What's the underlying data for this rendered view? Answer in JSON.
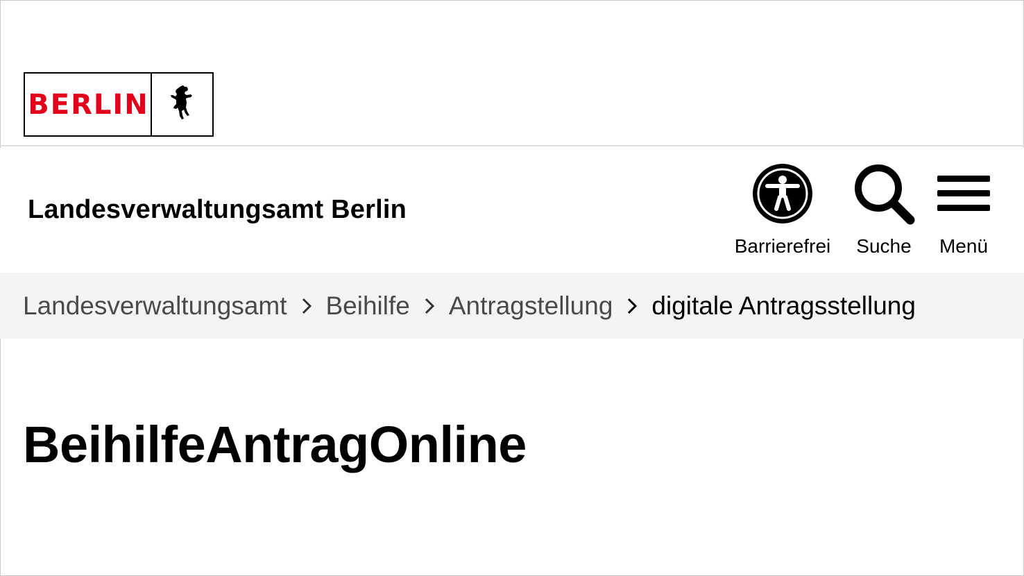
{
  "logo": {
    "text": "BERLIN",
    "brand_color": "#e3001b"
  },
  "header": {
    "site_title": "Landesverwaltungsamt Berlin",
    "tools": {
      "accessibility_label": "Barrierefrei",
      "search_label": "Suche",
      "menu_label": "Menü"
    }
  },
  "breadcrumb": {
    "items": [
      "Landesverwaltungsamt",
      "Beihilfe",
      "Antragstellung"
    ],
    "current": "digitale Antragsstellung"
  },
  "main": {
    "title": "BeihilfeAntragOnline"
  },
  "icons": {
    "accessibility": "accessibility-icon",
    "search": "search-icon",
    "menu": "hamburger-menu-icon",
    "breadcrumb_separator": "chevron-right-icon",
    "logo": "berlin-bear-icon"
  }
}
